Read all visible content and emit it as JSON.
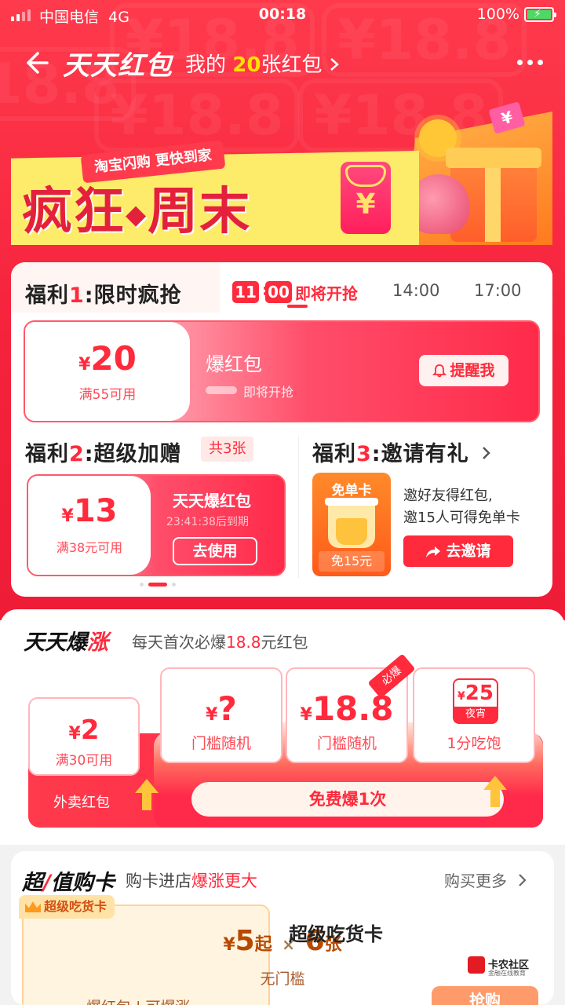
{
  "status": {
    "carrier": "中国电信",
    "network": "4G",
    "time": "00:18",
    "battery": "100%"
  },
  "nav": {
    "title": "天天红包",
    "mine_prefix": "我的",
    "mine_count": "20",
    "mine_suffix": "张红包"
  },
  "banner": {
    "subtitle": "淘宝闪购 更快到家",
    "title_left": "疯狂",
    "title_right": "周末",
    "envelope_symbol": "¥",
    "ticket_symbol": "¥"
  },
  "welfare1": {
    "label": "福利",
    "num": "1",
    "text": ":限时疯抢",
    "timer_h": "11",
    "timer_m": "00",
    "status_tab": "即将开抢",
    "tabs": [
      "14:00",
      "17:00"
    ],
    "coupon": {
      "currency": "¥",
      "amount": "20",
      "condition": "满55可用",
      "name": "爆红包",
      "status": "即将开抢",
      "remind": "提醒我"
    }
  },
  "welfare2": {
    "label": "福利",
    "num": "2",
    "text": ":超级加赠",
    "badge": "共3张",
    "coupon": {
      "currency": "¥",
      "amount": "13",
      "condition": "满38元可用",
      "name": "天天爆红包",
      "expiry": "23:41:38后到期",
      "button": "去使用"
    }
  },
  "welfare3": {
    "label": "福利",
    "num": "3",
    "text": ":邀请有礼",
    "card_title": "免单卡",
    "card_price": "免15元",
    "desc_line1": "邀好友得红包,",
    "desc_line2": "邀15人可得免单卡",
    "button": "去邀请"
  },
  "baozhang": {
    "title_a": "天天爆",
    "title_b": "涨",
    "subtitle_pre": "每天首次必爆",
    "subtitle_hl": "18.8",
    "subtitle_post": "元红包",
    "cards": [
      {
        "currency": "¥",
        "amount": "2",
        "label": "满30可用",
        "footer": "外卖红包"
      },
      {
        "currency": "¥",
        "amount": "?",
        "label": "门槛随机"
      },
      {
        "currency": "¥",
        "amount": "18.8",
        "label": "门槛随机",
        "badge": "必爆"
      },
      {
        "currency": "¥",
        "amount": "25",
        "tag": "夜宵",
        "label": "1分吃饱"
      }
    ],
    "button": "免费爆1次"
  },
  "buycard": {
    "title_a": "超",
    "title_b": "值购卡",
    "subtitle_pre": "购卡进店",
    "subtitle_hl": "爆涨更大",
    "more": "购买更多",
    "tag": "超级吃货卡",
    "currency": "¥",
    "price": "5",
    "price_suffix": "起",
    "times": "×",
    "count": "6",
    "count_unit": "张",
    "threshold": "无门槛",
    "tail": "爆红包 | 可爆涨",
    "name": "超级吃货卡",
    "button": "抢购"
  },
  "watermark": {
    "line1": "卡农社区",
    "line2": "金融在线教育"
  },
  "colors": {
    "primary_red": "#ff2a3c",
    "banner_yellow": "#fdeb6a",
    "battery_green": "#4cd964"
  }
}
